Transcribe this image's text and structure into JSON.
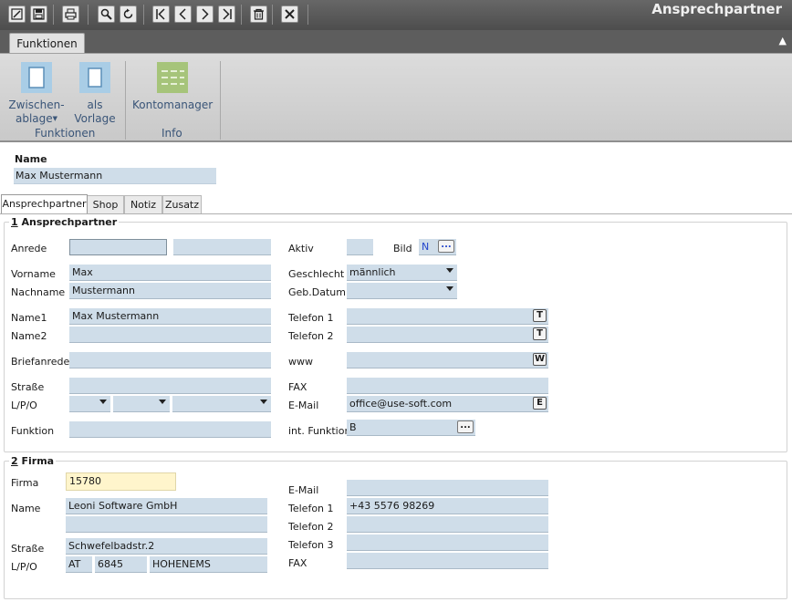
{
  "app": {
    "title": "Ansprechpartner"
  },
  "toolbar": {
    "icons": [
      "edit-icon",
      "save-icon",
      "print-icon",
      "search-icon",
      "refresh-icon",
      "first-icon",
      "prev-icon",
      "next-icon",
      "last-icon",
      "delete-icon",
      "close-icon"
    ]
  },
  "ribbon": {
    "tab": "Funktionen",
    "buttons": {
      "clipboard_line1": "Zwischen-",
      "clipboard_line2": "ablage",
      "template_line1": "als",
      "template_line2": "Vorlage",
      "account_manager": "Kontomanager"
    },
    "groups": {
      "functions": "Funktionen",
      "info": "Info"
    }
  },
  "header": {
    "name_label": "Name",
    "name_value": "Max Mustermann"
  },
  "tabs": [
    "Ansprechpartner",
    "Shop",
    "Notiz",
    "Zusatz"
  ],
  "section1": {
    "num": "1",
    "title": " Ansprechpartner",
    "labels": {
      "anrede": "Anrede",
      "vorname": "Vorname",
      "nachname": "Nachname",
      "name1": "Name1",
      "name2": "Name2",
      "briefanrede": "Briefanrede",
      "strasse": "Straße",
      "lpo": "L/P/O",
      "funktion": "Funktion",
      "aktiv": "Aktiv",
      "bild": "Bild",
      "geschlecht": "Geschlecht",
      "gebdatum": "Geb.Datum",
      "telefon1": "Telefon 1",
      "telefon2": "Telefon 2",
      "www": "www",
      "fax": "FAX",
      "email": "E-Mail",
      "int_funktion": "int. Funktion"
    },
    "values": {
      "vorname": "Max",
      "nachname": "Mustermann",
      "name1": "Max Mustermann",
      "bild": "N",
      "geschlecht": "männlich",
      "email": "office@use-soft.com",
      "int_funktion": "B"
    },
    "keys": {
      "telefon1": "T",
      "telefon2": "T",
      "www": "W",
      "email": "E"
    },
    "ellipsis": "..."
  },
  "section2": {
    "num": "2",
    "title": " Firma",
    "labels": {
      "firma": "Firma",
      "name": "Name",
      "strasse": "Straße",
      "lpo": "L/P/O",
      "email": "E-Mail",
      "telefon1": "Telefon 1",
      "telefon2": "Telefon 2",
      "telefon3": "Telefon 3",
      "fax": "FAX"
    },
    "values": {
      "firma": "15780",
      "name": "Leoni Software GmbH",
      "strasse": "Schwefelbadstr.2",
      "land": "AT",
      "plz": "6845",
      "ort": "HOHENEMS",
      "telefon1": "+43 5576 98269"
    }
  },
  "colors": {
    "field_bg": "#cfdde9",
    "highlight_bg": "#fff5cc",
    "ribbon_text": "#3a5578",
    "titlebar": "#555555"
  }
}
